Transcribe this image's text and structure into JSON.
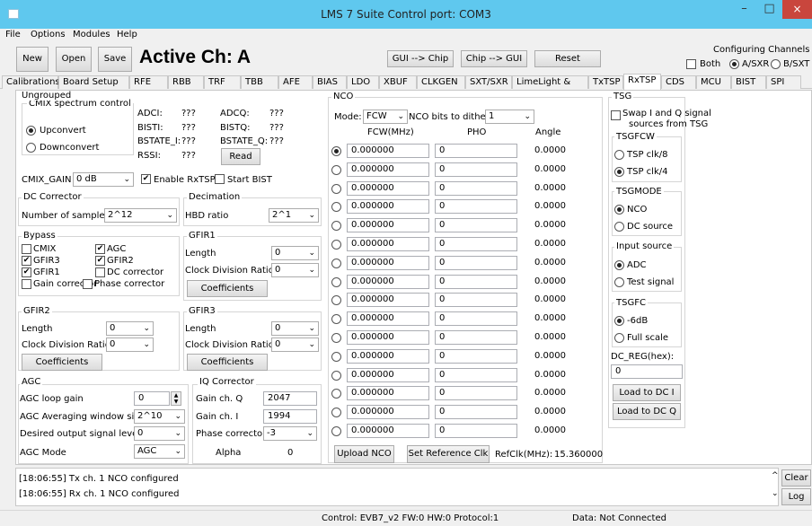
{
  "window": {
    "title": "LMS 7 Suite  Control port: COM3",
    "minimize": "–",
    "maximize": "□",
    "close": "×"
  },
  "menu": [
    "File",
    "Options",
    "Modules",
    "Help"
  ],
  "toolbar": {
    "new": "New",
    "open": "Open",
    "save": "Save",
    "active_ch": "Active Ch: A",
    "gui_to_chip": "GUI --> Chip",
    "chip_to_gui": "Chip --> GUI",
    "reset": "Reset",
    "cfg_title": "Configuring Channels",
    "both": "Both",
    "a": "A/SXR",
    "b": "B/SXT"
  },
  "tabs": [
    "Calibrations",
    "Board Setup",
    "RFE",
    "RBB",
    "TRF",
    "TBB",
    "AFE",
    "BIAS",
    "LDO",
    "XBUF",
    "CLKGEN",
    "SXT/SXR",
    "LimeLight & PAD",
    "TxTSP",
    "RxTSP",
    "CDS",
    "MCU",
    "BIST",
    "SPI"
  ],
  "ungrouped": {
    "title": "Ungrouped",
    "cmix_ctrl": "CMIX spectrum control",
    "upconvert": "Upconvert",
    "downconvert": "Downconvert",
    "adci": "ADCI:",
    "adci_v": "???",
    "adcq": "ADCQ:",
    "adcq_v": "???",
    "bisti": "BISTI:",
    "bisti_v": "???",
    "bistq": "BISTQ:",
    "bistq_v": "???",
    "bstate_i": "BSTATE_I:",
    "bstate_i_v": "???",
    "bstate_q": "BSTATE_Q:",
    "bstate_q_v": "???",
    "rssi": "RSSI:",
    "rssi_v": "???",
    "read": "Read",
    "cmix_gain": "CMIX_GAIN",
    "cmix_gain_v": "0 dB",
    "enable_rxtsp": "Enable RxTSP",
    "start_bist": "Start BIST"
  },
  "dc": {
    "title": "DC Corrector",
    "nsamples": "Number of samples",
    "nsamples_v": "2^12"
  },
  "decim": {
    "title": "Decimation",
    "hbd": "HBD ratio",
    "hbd_v": "2^1"
  },
  "bypass": {
    "title": "Bypass",
    "items": [
      "CMIX",
      "AGC",
      "GFIR3",
      "GFIR2",
      "GFIR1",
      "DC corrector",
      "Gain corrector",
      "Phase corrector"
    ]
  },
  "gfir1": {
    "title": "GFIR1",
    "length": "Length",
    "length_v": "0",
    "cdr": "Clock Division Ratio:",
    "cdr_v": "0",
    "coef": "Coefficients"
  },
  "gfir2": {
    "title": "GFIR2",
    "length": "Length",
    "length_v": "0",
    "cdr": "Clock Division Ratio:",
    "cdr_v": "0",
    "coef": "Coefficients"
  },
  "gfir3": {
    "title": "GFIR3",
    "length": "Length",
    "length_v": "0",
    "cdr": "Clock Division Ratio:",
    "cdr_v": "0",
    "coef": "Coefficients"
  },
  "agc": {
    "title": "AGC",
    "loop": "AGC loop gain",
    "loop_v": "0",
    "avg": "AGC Averaging window size",
    "avg_v": "2^10",
    "desired": "Desired output signal level",
    "desired_v": "0",
    "mode": "AGC Mode",
    "mode_v": "AGC"
  },
  "iq": {
    "title": "IQ Corrector",
    "gq": "Gain ch. Q",
    "gq_v": "2047",
    "gi": "Gain ch. I",
    "gi_v": "1994",
    "phase": "Phase corrector",
    "phase_v": "-3",
    "alpha": "Alpha",
    "alpha_v": "0"
  },
  "nco": {
    "title": "NCO",
    "mode": "Mode:",
    "mode_v": "FCW",
    "dither": "NCO bits to dither:",
    "dither_v": "1",
    "h_fcw": "FCW(MHz)",
    "h_pho": "PHO",
    "h_angle": "Angle",
    "rows": [
      {
        "fcw": "0.000000",
        "pho": "0",
        "angle": "0.0000"
      },
      {
        "fcw": "0.000000",
        "pho": "0",
        "angle": "0.0000"
      },
      {
        "fcw": "0.000000",
        "pho": "0",
        "angle": "0.0000"
      },
      {
        "fcw": "0.000000",
        "pho": "0",
        "angle": "0.0000"
      },
      {
        "fcw": "0.000000",
        "pho": "0",
        "angle": "0.0000"
      },
      {
        "fcw": "0.000000",
        "pho": "0",
        "angle": "0.0000"
      },
      {
        "fcw": "0.000000",
        "pho": "0",
        "angle": "0.0000"
      },
      {
        "fcw": "0.000000",
        "pho": "0",
        "angle": "0.0000"
      },
      {
        "fcw": "0.000000",
        "pho": "0",
        "angle": "0.0000"
      },
      {
        "fcw": "0.000000",
        "pho": "0",
        "angle": "0.0000"
      },
      {
        "fcw": "0.000000",
        "pho": "0",
        "angle": "0.0000"
      },
      {
        "fcw": "0.000000",
        "pho": "0",
        "angle": "0.0000"
      },
      {
        "fcw": "0.000000",
        "pho": "0",
        "angle": "0.0000"
      },
      {
        "fcw": "0.000000",
        "pho": "0",
        "angle": "0.0000"
      },
      {
        "fcw": "0.000000",
        "pho": "0",
        "angle": "0.0000"
      },
      {
        "fcw": "0.000000",
        "pho": "0",
        "angle": "0.0000"
      }
    ],
    "upload": "Upload NCO",
    "setref": "Set Reference Clk",
    "refclk": "RefClk(MHz):",
    "refclk_v": "15.360000"
  },
  "tsg": {
    "title": "TSG",
    "swap": "Swap I and Q signal",
    "swap2": "sources from TSG",
    "tsgfcw": "TSGFCW",
    "clk8": "TSP clk/8",
    "clk4": "TSP clk/4",
    "tsgmode": "TSGMODE",
    "nco": "NCO",
    "dc": "DC source",
    "input": "Input source",
    "adc": "ADC",
    "test": "Test signal",
    "tsgfc": "TSGFC",
    "m6": "-6dB",
    "full": "Full scale",
    "dcreg": "DC_REG(hex):",
    "dcreg_v": "0",
    "load_i": "Load to DC I",
    "load_q": "Load to DC Q"
  },
  "log": {
    "lines": [
      "[18:06:55] Tx ch. 1 NCO configured",
      "[18:06:55] Rx ch. 1 NCO configured"
    ],
    "clear": "Clear",
    "log": "Log"
  },
  "status": {
    "control": "Control: EVB7_v2  FW:0 HW:0 Protocol:1",
    "data": "Data: Not Connected"
  }
}
